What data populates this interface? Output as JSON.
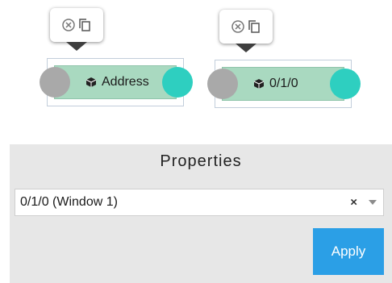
{
  "nodes": [
    {
      "label": "Address",
      "icon": "cube-icon"
    },
    {
      "label": "0/1/0",
      "icon": "cube-icon"
    }
  ],
  "node_toolbar": {
    "icons": [
      "close-circle-icon",
      "copy-icon"
    ]
  },
  "properties": {
    "title": "Properties",
    "selected_value": "0/1/0 (Window 1)",
    "clear_glyph": "×",
    "apply_label": "Apply"
  },
  "colors": {
    "node_fill": "#a9d9c0",
    "input_port": "#a9a9a9",
    "output_port": "#2ecfc0",
    "apply_button": "#2b9fe6",
    "panel_background": "#e7e7e7"
  }
}
